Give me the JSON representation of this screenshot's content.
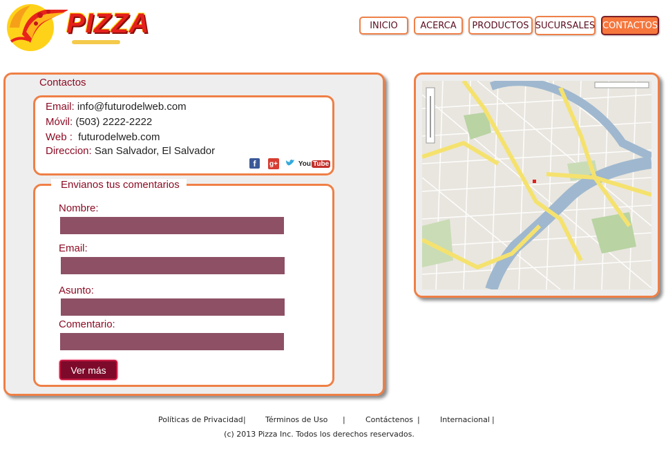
{
  "brand": {
    "logo_text": "PIZZA"
  },
  "nav": [
    {
      "label": "INICIO",
      "active": false
    },
    {
      "label": "ACERCA",
      "active": false
    },
    {
      "label": "PRODUCTOS",
      "active": false
    },
    {
      "label": "SUCURSALES",
      "active": false
    },
    {
      "label": "CONTACTOS",
      "active": true
    }
  ],
  "contacts": {
    "title": "Contactos",
    "email_label": "Email:",
    "email_value": "info@futurodelweb.com",
    "mobile_label": "Móvil:",
    "mobile_value": "(503) 2222-2222",
    "web_label": "Web :",
    "web_value": "futurodelweb.com",
    "address_label": "Direccion:",
    "address_value": "San Salvador, El Salvador",
    "social": {
      "facebook": "f",
      "googleplus": "g+",
      "twitter": "t",
      "youtube_you": "You",
      "youtube_tube": "Tube"
    }
  },
  "form": {
    "title": "Envianos tus comentarios",
    "name_label": "Nombre:",
    "email_label": "Email:",
    "subject_label": "Asunto:",
    "comment_label": "Comentario:",
    "name_value": "",
    "email_value": "",
    "subject_value": "",
    "comment_value": "",
    "submit_label": "Ver más"
  },
  "footer": {
    "links": [
      "Políticas de Privacidad",
      "Términos de Uso",
      "Contáctenos",
      "Internacional"
    ],
    "separator": "|",
    "copyright": "(c) 2013 Pizza Inc. Todos los derechos reservados."
  },
  "colors": {
    "accent_orange": "#ef7f45",
    "label_red": "#8c0b23",
    "field_fill": "#8d5064",
    "button_fill": "#7d0a2a",
    "nav_active": "#f6763c"
  }
}
